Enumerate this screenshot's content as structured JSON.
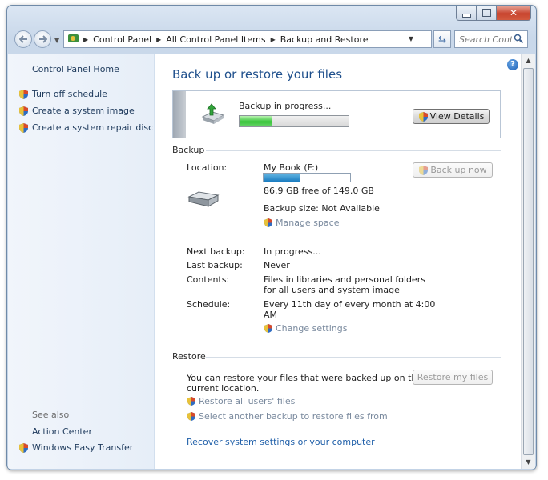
{
  "window": {
    "minimize": "minimize",
    "maximize": "maximize",
    "close": "✕"
  },
  "address_bar": {
    "crumbs": [
      "Control Panel",
      "All Control Panel Items",
      "Backup and Restore"
    ],
    "search_placeholder": "Search Cont..."
  },
  "sidebar": {
    "home": "Control Panel Home",
    "tasks": [
      {
        "label": "Turn off schedule",
        "icon": "shield-icon"
      },
      {
        "label": "Create a system image",
        "icon": "shield-icon"
      },
      {
        "label": "Create a system repair disc",
        "icon": "shield-icon"
      }
    ],
    "see_also": "See also",
    "see_also_links": [
      {
        "label": "Action Center"
      },
      {
        "label": "Windows Easy Transfer",
        "icon": "shield-icon"
      }
    ]
  },
  "main": {
    "title": "Back up or restore your files",
    "progress": {
      "label": "Backup in progress...",
      "fraction": 0.3,
      "button": "View Details"
    },
    "backup": {
      "heading": "Backup",
      "location_label": "Location:",
      "location_value": "My Book (F:)",
      "capacity_used_fraction": 0.42,
      "free_text": "86.9 GB free of 149.0 GB",
      "size_text": "Backup size: Not Available",
      "manage_space": "Manage space",
      "backup_now": "Back up now",
      "next_label": "Next backup:",
      "next_value": "In progress...",
      "last_label": "Last backup:",
      "last_value": "Never",
      "contents_label": "Contents:",
      "contents_value_1": "Files in libraries and personal folders",
      "contents_value_2": "for all users and system image",
      "schedule_label": "Schedule:",
      "schedule_value_1": "Every 11th day of every month at 4:00",
      "schedule_value_2": "AM",
      "change_settings": "Change settings"
    },
    "restore": {
      "heading": "Restore",
      "text_1": "You can restore your files that were backed up on the",
      "text_2": "current location.",
      "restore_button": "Restore my files",
      "restore_all": "Restore all users' files",
      "select_another": "Select another backup to restore files from",
      "recover": "Recover system settings or your computer"
    }
  },
  "colors": {
    "link": "#1e5ea8",
    "title": "#1e4f8c",
    "progress": "#37c43a",
    "capacity": "#1a7cc0"
  }
}
